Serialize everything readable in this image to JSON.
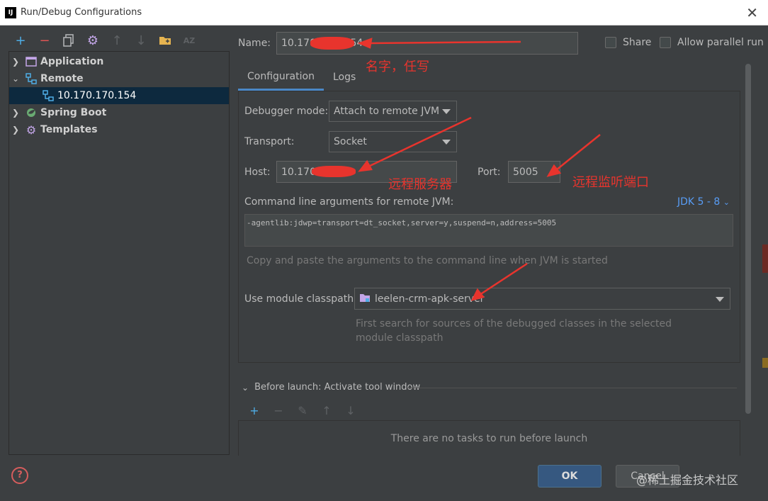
{
  "window": {
    "title": "Run/Debug Configurations",
    "app_icon_text": "IJ"
  },
  "left_toolbar": {
    "icons": [
      "add-icon",
      "remove-icon",
      "copy-icon",
      "gear-icon",
      "arrow-up-icon",
      "arrow-down-icon",
      "folder-icon",
      "sort-az-icon"
    ]
  },
  "tree": {
    "items": [
      {
        "label": "Application",
        "icon": "application-icon",
        "expanded": false
      },
      {
        "label": "Remote",
        "icon": "remote-icon",
        "expanded": true
      },
      {
        "label": "10.170.170.154",
        "icon": "remote-config-icon",
        "selected": true
      },
      {
        "label": "Spring Boot",
        "icon": "spring-boot-icon",
        "expanded": false
      },
      {
        "label": "Templates",
        "icon": "wrench-icon",
        "expanded": false
      }
    ]
  },
  "form": {
    "name_label": "Name:",
    "name_value": "10.170.",
    "name_value_tail": "54",
    "share_label": "Share",
    "parallel_label": "Allow parallel run",
    "tabs": [
      "Configuration",
      "Logs"
    ],
    "debugger_mode_label": "Debugger mode:",
    "debugger_mode_value": "Attach to remote JVM",
    "transport_label": "Transport:",
    "transport_value": "Socket",
    "host_label": "Host:",
    "host_value": "10.170.",
    "port_label": "Port:",
    "port_value": "5005",
    "cmd_label": "Command line arguments for remote JVM:",
    "jdk_link": "JDK 5 - 8",
    "cmd_value": "-agentlib:jdwp=transport=dt_socket,server=y,suspend=n,address=5005",
    "cmd_hint": "Copy and paste the arguments to the command line when JVM is started",
    "classpath_label": "Use module classpath:",
    "classpath_value": "leelen-crm-apk-server",
    "classpath_hint_1": "First search for sources of the debugged classes in the selected",
    "classpath_hint_2": "module classpath"
  },
  "before_launch": {
    "title": "Before launch: Activate tool window",
    "empty_message": "There are no tasks to run before launch"
  },
  "buttons": {
    "ok": "OK",
    "cancel": "Cancel"
  },
  "annotations": {
    "name_note": "名字，任写",
    "host_note": "远程服务器",
    "port_note": "远程监听端口",
    "annotation_color": "#e8342d"
  },
  "watermark": "@稀土掘金技术社区",
  "colors": {
    "background": "#3c3f41",
    "selection": "#0d293e",
    "accent": "#4a88c7",
    "link": "#589df6",
    "ok_button": "#365880"
  }
}
